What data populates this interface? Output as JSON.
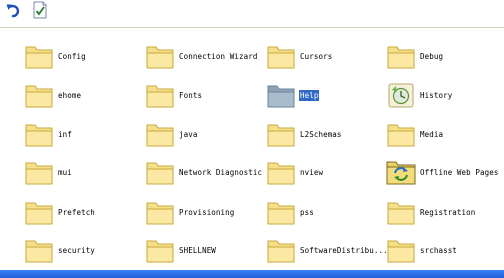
{
  "toolbar": {
    "buttons": [
      {
        "icon": "undo-icon"
      },
      {
        "icon": "properties-icon"
      }
    ]
  },
  "colors": {
    "folder_fill": "#f5df8a",
    "folder_stroke": "#c9a83c",
    "selection": "#316ac5",
    "taskbar": "#245edb"
  },
  "items": [
    {
      "label": "Config",
      "icon": "folder-icon"
    },
    {
      "label": "Connection Wizard",
      "icon": "folder-icon"
    },
    {
      "label": "Cursors",
      "icon": "folder-icon"
    },
    {
      "label": "Debug",
      "icon": "folder-icon"
    },
    {
      "label": "ehome",
      "icon": "folder-icon"
    },
    {
      "label": "Fonts",
      "icon": "folder-icon"
    },
    {
      "label": "Help",
      "icon": "folder-icon",
      "selected": true
    },
    {
      "label": "History",
      "icon": "history-folder-icon"
    },
    {
      "label": "inf",
      "icon": "folder-icon"
    },
    {
      "label": "java",
      "icon": "folder-icon"
    },
    {
      "label": "L2Schemas",
      "icon": "folder-icon"
    },
    {
      "label": "Media",
      "icon": "folder-icon"
    },
    {
      "label": "mui",
      "icon": "folder-icon"
    },
    {
      "label": "Network Diagnostic",
      "icon": "folder-icon"
    },
    {
      "label": "nview",
      "icon": "folder-icon"
    },
    {
      "label": "Offline Web Pages",
      "icon": "offline-folder-icon"
    },
    {
      "label": "Prefetch",
      "icon": "folder-icon"
    },
    {
      "label": "Provisioning",
      "icon": "folder-icon"
    },
    {
      "label": "pss",
      "icon": "folder-icon"
    },
    {
      "label": "Registration",
      "icon": "folder-icon"
    },
    {
      "label": "security",
      "icon": "folder-icon"
    },
    {
      "label": "SHELLNEW",
      "icon": "folder-icon"
    },
    {
      "label": "SoftwareDistribu...",
      "icon": "folder-icon"
    },
    {
      "label": "srchasst",
      "icon": "folder-icon"
    }
  ]
}
